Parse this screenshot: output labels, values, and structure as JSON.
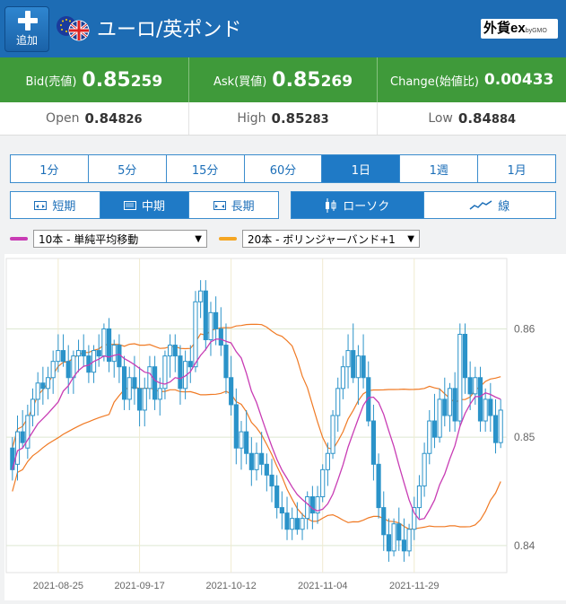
{
  "header": {
    "add_label": "追加",
    "pair_name": "ユーロ/英ポンド",
    "logo_text": "外貨ex",
    "logo_sub": "byGMO"
  },
  "quote": {
    "bid_label": "Bid(売値)",
    "bid_big": "0.85",
    "bid_small": "259",
    "ask_label": "Ask(買値)",
    "ask_big": "0.85",
    "ask_small": "269",
    "change_label": "Change(始値比)",
    "change_value": "0.00433"
  },
  "ohl": {
    "open_label": "Open",
    "open_big": "0.84",
    "open_small": "826",
    "high_label": "High",
    "high_big": "0.85",
    "high_small": "283",
    "low_label": "Low",
    "low_big": "0.84",
    "low_small": "884"
  },
  "periods": [
    "1分",
    "5分",
    "15分",
    "60分",
    "1日",
    "1週",
    "1月"
  ],
  "period_selected": "1日",
  "terms": [
    "短期",
    "中期",
    "長期"
  ],
  "term_selected": "中期",
  "chart_types": [
    "ローソク",
    "線"
  ],
  "chart_type_selected": "ローソク",
  "indicators": {
    "ma": {
      "label": "10本 - 単純平均移動",
      "color": "#c83cb4"
    },
    "bb": {
      "label": "20本 - ボリンジャーバンド+1",
      "color": "#f5a623"
    }
  },
  "colors": {
    "header_blue": "#1d6cb4",
    "quote_green": "#3f9a3a",
    "candle": "#2b93c9",
    "ma_line": "#c83cb4",
    "bb_line": "#f07a24"
  },
  "chart_data": {
    "type": "candlestick",
    "title": "",
    "xlabel": "",
    "ylabel": "",
    "ylim": [
      0.8375,
      0.8665
    ],
    "y_ticks": [
      "0.84",
      "0.85",
      "0.86"
    ],
    "x_ticks": [
      "2021-08-25",
      "2021-09-17",
      "2021-10-12",
      "2021-11-04",
      "2021-11-29"
    ],
    "grid": true,
    "ohlc": [
      [
        0.849,
        0.85,
        0.846,
        0.847
      ],
      [
        0.8475,
        0.852,
        0.846,
        0.8505
      ],
      [
        0.8505,
        0.8525,
        0.849,
        0.8495
      ],
      [
        0.849,
        0.853,
        0.848,
        0.852
      ],
      [
        0.852,
        0.8545,
        0.851,
        0.8535
      ],
      [
        0.8535,
        0.856,
        0.852,
        0.855
      ],
      [
        0.855,
        0.8565,
        0.853,
        0.8545
      ],
      [
        0.8545,
        0.8565,
        0.8535,
        0.8555
      ],
      [
        0.8555,
        0.858,
        0.854,
        0.857
      ],
      [
        0.857,
        0.8595,
        0.856,
        0.858
      ],
      [
        0.858,
        0.8595,
        0.8565,
        0.857
      ],
      [
        0.857,
        0.8585,
        0.854,
        0.8555
      ],
      [
        0.8555,
        0.858,
        0.854,
        0.8575
      ],
      [
        0.8575,
        0.859,
        0.856,
        0.858
      ],
      [
        0.858,
        0.8595,
        0.8565,
        0.8575
      ],
      [
        0.8575,
        0.8585,
        0.855,
        0.856
      ],
      [
        0.856,
        0.8585,
        0.855,
        0.858
      ],
      [
        0.858,
        0.8595,
        0.8565,
        0.8575
      ],
      [
        0.8575,
        0.8605,
        0.857,
        0.86
      ],
      [
        0.86,
        0.861,
        0.856,
        0.857
      ],
      [
        0.857,
        0.859,
        0.8555,
        0.8585
      ],
      [
        0.8585,
        0.8595,
        0.855,
        0.8565
      ],
      [
        0.8565,
        0.8575,
        0.8525,
        0.8535
      ],
      [
        0.8535,
        0.8565,
        0.8525,
        0.8555
      ],
      [
        0.8555,
        0.8575,
        0.853,
        0.8545
      ],
      [
        0.8545,
        0.8565,
        0.851,
        0.8525
      ],
      [
        0.8525,
        0.8555,
        0.851,
        0.8545
      ],
      [
        0.8545,
        0.8575,
        0.8535,
        0.8565
      ],
      [
        0.8565,
        0.8575,
        0.8525,
        0.8535
      ],
      [
        0.8535,
        0.8555,
        0.852,
        0.8545
      ],
      [
        0.8545,
        0.858,
        0.8535,
        0.8575
      ],
      [
        0.8575,
        0.8595,
        0.8555,
        0.8585
      ],
      [
        0.8585,
        0.8595,
        0.856,
        0.8575
      ],
      [
        0.8575,
        0.8585,
        0.853,
        0.8545
      ],
      [
        0.8545,
        0.858,
        0.8535,
        0.857
      ],
      [
        0.857,
        0.8585,
        0.855,
        0.8565
      ],
      [
        0.8565,
        0.8635,
        0.856,
        0.8625
      ],
      [
        0.8625,
        0.8645,
        0.861,
        0.8635
      ],
      [
        0.8635,
        0.8645,
        0.858,
        0.859
      ],
      [
        0.859,
        0.8625,
        0.8575,
        0.8615
      ],
      [
        0.8615,
        0.863,
        0.8585,
        0.86
      ],
      [
        0.86,
        0.862,
        0.8575,
        0.8585
      ],
      [
        0.8585,
        0.8605,
        0.854,
        0.8555
      ],
      [
        0.8555,
        0.8575,
        0.852,
        0.853
      ],
      [
        0.853,
        0.8545,
        0.8475,
        0.849
      ],
      [
        0.849,
        0.8515,
        0.847,
        0.8505
      ],
      [
        0.8505,
        0.8525,
        0.8475,
        0.8485
      ],
      [
        0.8485,
        0.85,
        0.8455,
        0.847
      ],
      [
        0.847,
        0.8495,
        0.846,
        0.8485
      ],
      [
        0.8485,
        0.8505,
        0.8465,
        0.8475
      ],
      [
        0.8475,
        0.8485,
        0.845,
        0.8465
      ],
      [
        0.8465,
        0.848,
        0.844,
        0.8455
      ],
      [
        0.8455,
        0.8465,
        0.8425,
        0.8435
      ],
      [
        0.8435,
        0.845,
        0.8415,
        0.843
      ],
      [
        0.843,
        0.8445,
        0.8405,
        0.8415
      ],
      [
        0.8415,
        0.8435,
        0.8405,
        0.8425
      ],
      [
        0.8425,
        0.844,
        0.841,
        0.8415
      ],
      [
        0.8415,
        0.843,
        0.8405,
        0.8425
      ],
      [
        0.8425,
        0.845,
        0.8415,
        0.8445
      ],
      [
        0.8445,
        0.8455,
        0.8415,
        0.843
      ],
      [
        0.843,
        0.8455,
        0.842,
        0.8445
      ],
      [
        0.8445,
        0.8475,
        0.844,
        0.847
      ],
      [
        0.847,
        0.8495,
        0.8455,
        0.8485
      ],
      [
        0.8485,
        0.8525,
        0.848,
        0.852
      ],
      [
        0.852,
        0.8555,
        0.8505,
        0.8545
      ],
      [
        0.8545,
        0.8575,
        0.8535,
        0.8565
      ],
      [
        0.8565,
        0.8595,
        0.8545,
        0.858
      ],
      [
        0.858,
        0.8605,
        0.855,
        0.8555
      ],
      [
        0.8555,
        0.8585,
        0.853,
        0.8575
      ],
      [
        0.8575,
        0.8595,
        0.8545,
        0.8555
      ],
      [
        0.8555,
        0.857,
        0.851,
        0.8515
      ],
      [
        0.8515,
        0.853,
        0.846,
        0.8475
      ],
      [
        0.8475,
        0.8485,
        0.8425,
        0.8435
      ],
      [
        0.8435,
        0.845,
        0.8395,
        0.841
      ],
      [
        0.841,
        0.8425,
        0.8385,
        0.8395
      ],
      [
        0.8395,
        0.8425,
        0.839,
        0.842
      ],
      [
        0.842,
        0.8435,
        0.8395,
        0.8405
      ],
      [
        0.8405,
        0.8425,
        0.8385,
        0.8395
      ],
      [
        0.8395,
        0.842,
        0.839,
        0.8415
      ],
      [
        0.8415,
        0.8445,
        0.8405,
        0.8435
      ],
      [
        0.8435,
        0.8465,
        0.8425,
        0.8455
      ],
      [
        0.8455,
        0.8495,
        0.8445,
        0.8485
      ],
      [
        0.8485,
        0.8525,
        0.8475,
        0.8515
      ],
      [
        0.8515,
        0.854,
        0.849,
        0.85
      ],
      [
        0.85,
        0.8545,
        0.8495,
        0.8535
      ],
      [
        0.8535,
        0.8555,
        0.851,
        0.852
      ],
      [
        0.852,
        0.855,
        0.8505,
        0.8545
      ],
      [
        0.8545,
        0.856,
        0.8505,
        0.8515
      ],
      [
        0.8515,
        0.8605,
        0.851,
        0.8595
      ],
      [
        0.8595,
        0.8605,
        0.854,
        0.8555
      ],
      [
        0.8555,
        0.857,
        0.8525,
        0.854
      ],
      [
        0.854,
        0.8565,
        0.853,
        0.8555
      ],
      [
        0.8555,
        0.8565,
        0.8505,
        0.8515
      ],
      [
        0.8515,
        0.8545,
        0.8505,
        0.8535
      ],
      [
        0.8535,
        0.855,
        0.8505,
        0.852
      ],
      [
        0.852,
        0.8535,
        0.8485,
        0.8495
      ],
      [
        0.8495,
        0.8535,
        0.849,
        0.8525
      ]
    ]
  }
}
